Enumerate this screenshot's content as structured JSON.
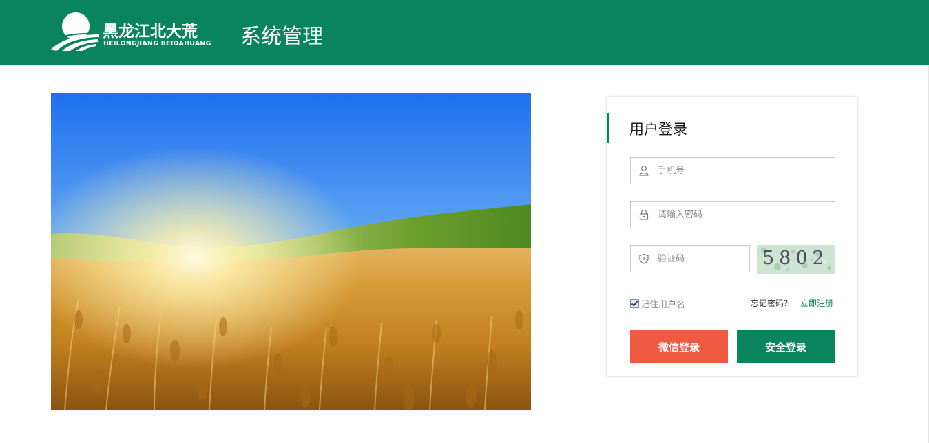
{
  "header": {
    "logo_cn": "黑龙江北大荒",
    "logo_en": "HEILONGJIANG  BEIDAHUANG",
    "system_title": "系统管理",
    "background_color": "#0a845c"
  },
  "login": {
    "title": "用户登录",
    "phone_placeholder": "手机号",
    "password_placeholder": "请输入密码",
    "captcha_placeholder": "验证码",
    "captcha_text": "5802",
    "remember_label": "记住用户名",
    "remember_checked": true,
    "forgot_label": "忘记密码？",
    "register_label": "立即注册",
    "wechat_button": "微信登录",
    "login_button": "安全登录",
    "accent_color": "#0a845c",
    "wechat_color": "#f05a40"
  },
  "icons": {
    "phone": "user-icon",
    "password": "lock-icon",
    "captcha": "shield-icon"
  }
}
